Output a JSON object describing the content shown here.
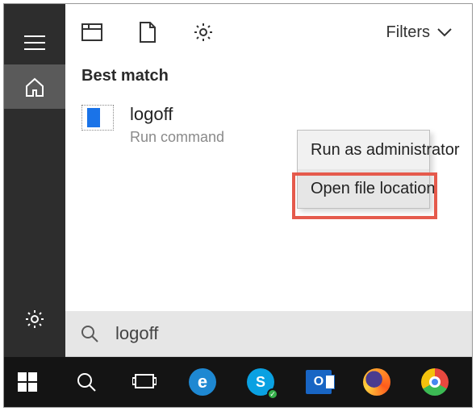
{
  "sidebar": {
    "menu_name": "menu-icon",
    "home_name": "home-icon",
    "settings_name": "gear-icon"
  },
  "toolbar": {
    "app_icon_name": "recent-icon",
    "doc_icon_name": "document-icon",
    "gear_icon_name": "gear-icon",
    "filters_label": "Filters"
  },
  "results": {
    "section_title": "Best match",
    "items": [
      {
        "title": "logoff",
        "subtitle": "Run command"
      }
    ]
  },
  "context_menu": {
    "items": [
      {
        "label": "Run as administrator"
      },
      {
        "label": "Open file location"
      }
    ]
  },
  "search": {
    "query": "logoff"
  },
  "taskbar": {
    "start_name": "windows-start-icon",
    "search_name": "search-icon",
    "taskview_name": "task-view-icon",
    "apps": [
      "edge-icon",
      "skype-icon",
      "outlook-icon",
      "firefox-icon",
      "chrome-icon"
    ]
  }
}
